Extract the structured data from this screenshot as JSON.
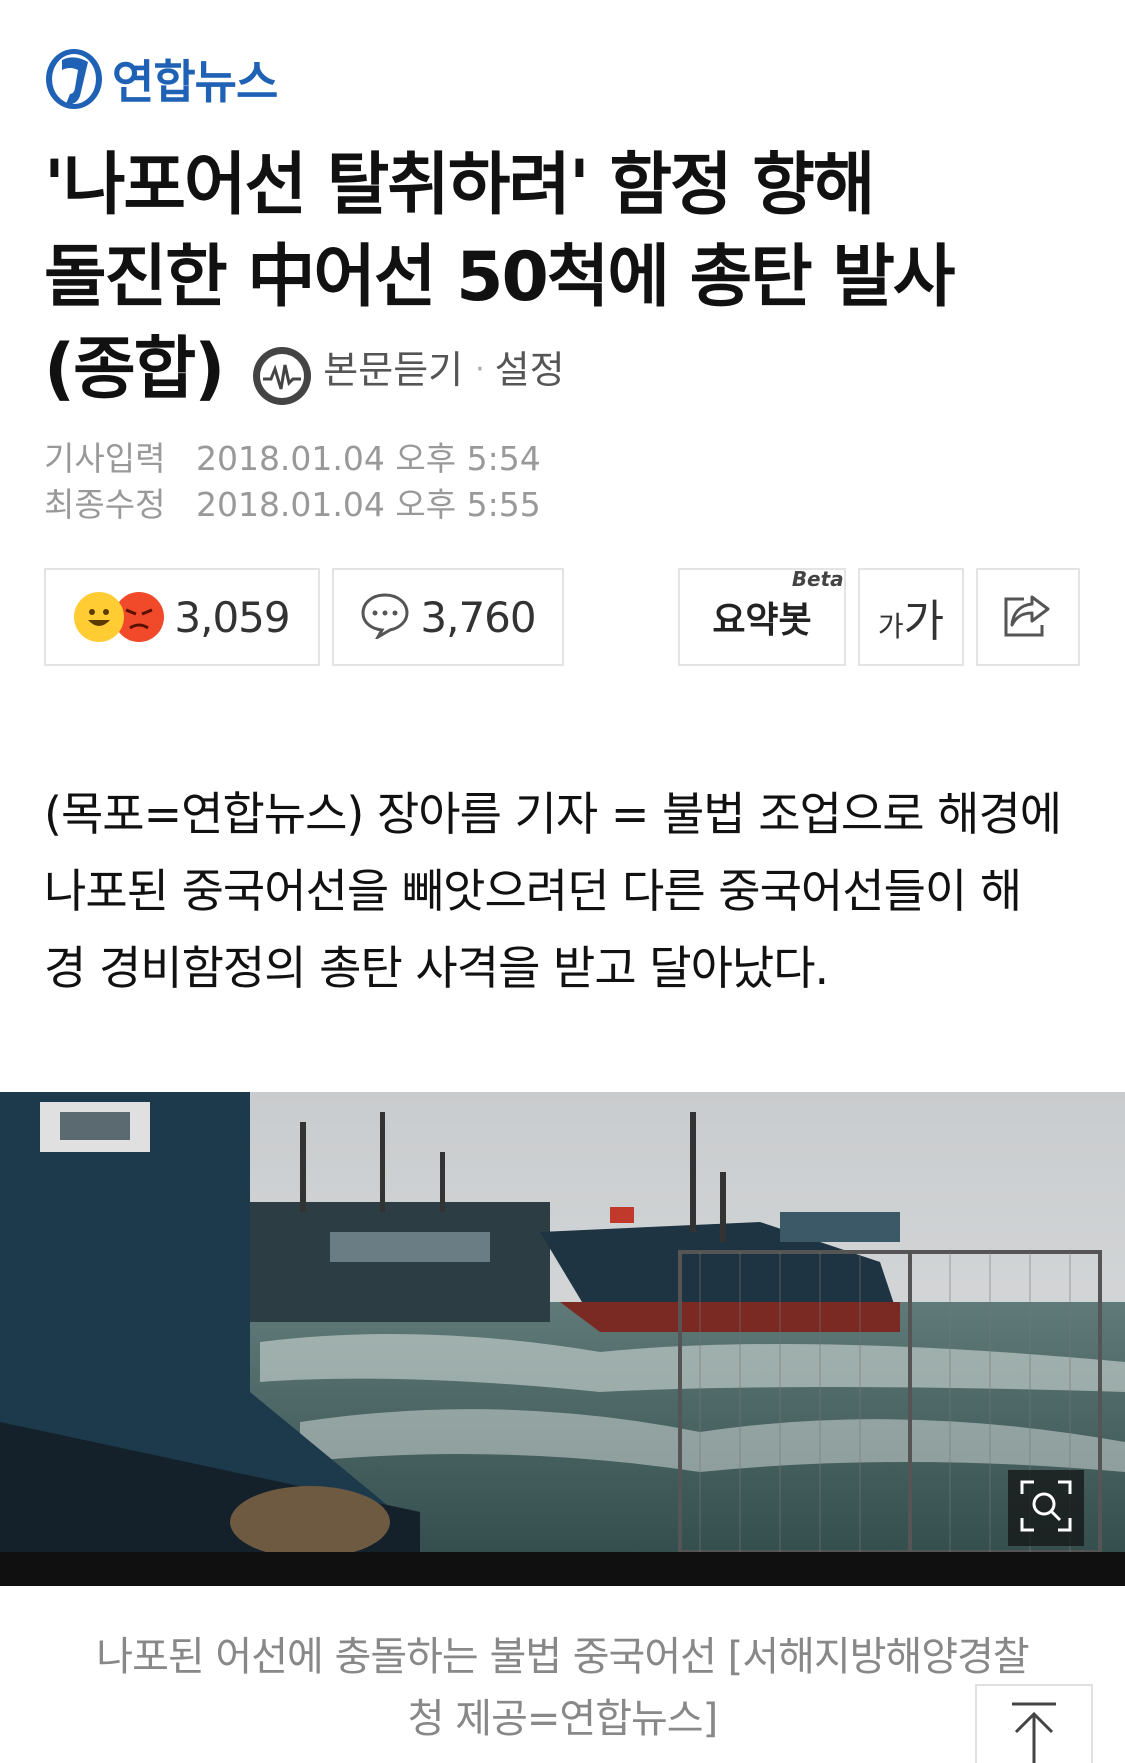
{
  "brand": {
    "name": "연합뉴스",
    "logo_glyph": "Y",
    "color": "#1f62b5"
  },
  "article": {
    "headline_line1": "'나포어선 탈취하려' 함정 향해",
    "headline_line2": "돌진한 中어선 50척에 총탄 발사",
    "headline_line3": "(종합)",
    "listen_label": "본문듣기",
    "listen_sep": "·",
    "settings_label": "설정",
    "published_key": "기사입력",
    "published_value": "2018.01.04 오후 5:54",
    "modified_key": "최종수정",
    "modified_value": "2018.01.04 오후 5:55",
    "body_line1": "(목포=연합뉴스) 장아름 기자 = 불법 조업으로 해경에",
    "body_line2": "나포된 중국어선을 빼앗으려던 다른 중국어선들이 해",
    "body_line3": "경 경비함정의 총탄 사격을 받고 달아났다.",
    "caption_line1": "나포된 어선에 충돌하는 불법 중국어선 [서해지방해양경찰",
    "caption_line2": "청 제공=연합뉴스]"
  },
  "toolbar": {
    "reaction_count": "3,059",
    "comment_count": "3,760",
    "summary_label": "요약봇",
    "summary_badge": "Beta",
    "font_small": "가",
    "font_large": "가"
  },
  "icons": {
    "reaction_smile": "smile-emoji-icon",
    "reaction_angry": "angry-emoji-icon",
    "comment": "speech-bubble-icon",
    "share": "share-icon",
    "listen": "audio-icon",
    "zoom": "magnifier-icon",
    "scroll_top": "arrow-up-icon"
  }
}
